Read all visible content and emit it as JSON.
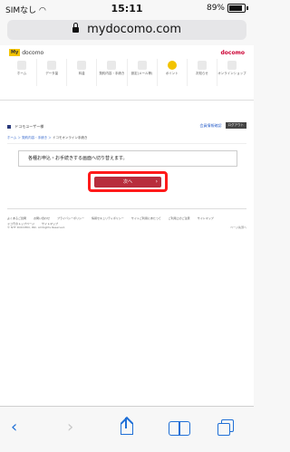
{
  "status_bar": {
    "carrier": "SIMなし",
    "time": "15:11",
    "battery": "89%"
  },
  "browser": {
    "url": "mydocomo.com"
  },
  "site_header": {
    "logo_text": "docomo",
    "logo_badge": "My",
    "brand": "docomo",
    "nav": [
      {
        "label": "ホーム",
        "icon": "home-icon"
      },
      {
        "label": "データ量",
        "icon": "data-icon"
      },
      {
        "label": "料金",
        "icon": "yen-icon"
      },
      {
        "label": "契約内容・手続き",
        "icon": "contract-icon"
      },
      {
        "label": "設定(メール等)",
        "icon": "settings-icon"
      },
      {
        "label": "ポイント",
        "icon": "point-icon"
      },
      {
        "label": "お知らせ",
        "icon": "bell-icon"
      },
      {
        "label": "オンラインショップ",
        "icon": "cart-icon"
      }
    ]
  },
  "subbar": {
    "user": "ドコモユーザー様",
    "link": "会員情報確認",
    "logout": "ログアウト"
  },
  "breadcrumb": {
    "home": "ホーム",
    "mid": "契約内容・手続き",
    "current": "ドコモオンライン手続き"
  },
  "notice": {
    "text": "各種お申込・お手続きする画面へ切り替えます。"
  },
  "next_button": {
    "label": "次へ"
  },
  "footer": {
    "links": [
      "よくあるご質問",
      "お問い合わせ",
      "プライバシーポリシー",
      "情報セキュリティポリシー",
      "サイトご利用にあたって",
      "ご利用上のご注意",
      "サイトマップ",
      "ドコモのトップページ",
      "サイトマップ"
    ],
    "copyright": "© NTT DOCOMO, INC. All Rights Reserved.",
    "top_link": "ページ先頭へ"
  },
  "colors": {
    "accent": "#b82c3c",
    "highlight": "#ff1a1a",
    "ios_blue": "#1f6fd6"
  }
}
